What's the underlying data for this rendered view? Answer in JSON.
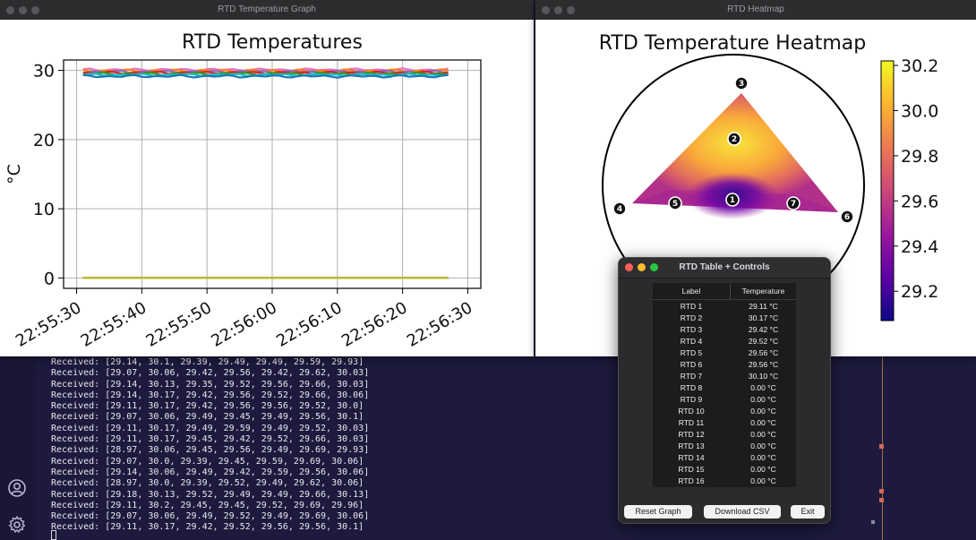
{
  "terminal": {
    "lines": [
      "Received: [29.14, 30.1, 29.39, 29.49, 29.49, 29.59, 29.93]",
      "Received: [29.07, 30.06, 29.42, 29.56, 29.42, 29.62, 30.03]",
      "Received: [29.14, 30.13, 29.35, 29.52, 29.56, 29.66, 30.03]",
      "Received: [29.14, 30.17, 29.42, 29.56, 29.52, 29.66, 30.06]",
      "Received: [29.11, 30.17, 29.42, 29.56, 29.56, 29.52, 30.0]",
      "Received: [29.07, 30.06, 29.49, 29.45, 29.49, 29.56, 30.1]",
      "Received: [29.11, 30.17, 29.49, 29.59, 29.49, 29.52, 30.03]",
      "Received: [29.11, 30.17, 29.45, 29.42, 29.52, 29.66, 30.03]",
      "Received: [28.97, 30.06, 29.45, 29.56, 29.49, 29.69, 29.93]",
      "Received: [29.07, 30.0, 29.39, 29.45, 29.59, 29.69, 30.06]",
      "Received: [29.14, 30.06, 29.49, 29.42, 29.59, 29.56, 30.06]",
      "Received: [28.97, 30.0, 29.39, 29.52, 29.49, 29.62, 30.06]",
      "Received: [29.18, 30.13, 29.52, 29.49, 29.49, 29.66, 30.13]",
      "Received: [29.11, 30.2, 29.45, 29.45, 29.52, 29.69, 29.96]",
      "Received: [29.07, 30.06, 29.49, 29.52, 29.49, 29.69, 30.06]",
      "Received: [29.11, 30.17, 29.42, 29.52, 29.56, 29.56, 30.1]"
    ],
    "sidebar_icons": [
      "account-icon",
      "settings-gear-icon"
    ]
  },
  "graph_window": {
    "title": "RTD Temperature Graph",
    "chart_data": {
      "type": "line",
      "title": "RTD Temperatures",
      "ylabel": "°C",
      "xlabel": "",
      "ylim": [
        -1.5,
        31.5
      ],
      "yticks": [
        0,
        10,
        20,
        30
      ],
      "x_tick_labels": [
        "22:55:30",
        "22:55:40",
        "22:55:50",
        "22:56:00",
        "22:56:10",
        "22:56:20",
        "22:56:30"
      ],
      "x_range_seconds": [
        -2,
        62
      ],
      "x_ticks_seconds": [
        0,
        10,
        20,
        30,
        40,
        50,
        60
      ],
      "data_x_range_seconds": [
        1,
        57
      ],
      "grid": true,
      "series": [
        {
          "color": "#e377c2",
          "level": 30.1
        },
        {
          "color": "#ff7f0e",
          "level": 29.95
        },
        {
          "color": "#9467bd",
          "level": 29.8
        },
        {
          "color": "#d62728",
          "level": 29.65
        },
        {
          "color": "#2ca02c",
          "level": 29.5
        },
        {
          "color": "#17becf",
          "level": 29.35
        },
        {
          "color": "#1f77b4",
          "level": 29.15
        },
        {
          "color": "#8c564b",
          "level": 0
        },
        {
          "color": "#7f7f7f",
          "level": 0
        },
        {
          "color": "#bcbd22",
          "level": 0
        }
      ]
    }
  },
  "heatmap_window": {
    "title": "RTD Heatmap",
    "chart_data": {
      "type": "heatmap",
      "title": "RTD Temperature Heatmap",
      "colorbar_ticks": [
        29.2,
        29.4,
        29.6,
        29.8,
        30.0,
        30.2
      ],
      "colorbar_range": [
        29.07,
        30.22
      ],
      "colormap": [
        "#0d0887",
        "#5c01a6",
        "#9c179e",
        "#cc4778",
        "#ed7953",
        "#fdb42f",
        "#f0f921"
      ],
      "sensors": [
        {
          "label": "1",
          "value": 29.11
        },
        {
          "label": "2",
          "value": 30.17
        },
        {
          "label": "3",
          "value": 29.42
        },
        {
          "label": "4",
          "value": 29.52
        },
        {
          "label": "5",
          "value": 29.56
        },
        {
          "label": "6",
          "value": 29.56
        },
        {
          "label": "7",
          "value": 30.1
        }
      ]
    }
  },
  "table_window": {
    "title": "RTD Table + Controls",
    "headers": {
      "label": "Label",
      "temperature": "Temperature"
    },
    "rows": [
      {
        "label": "RTD 1",
        "temp": "29.11 °C"
      },
      {
        "label": "RTD 2",
        "temp": "30.17 °C"
      },
      {
        "label": "RTD 3",
        "temp": "29.42 °C"
      },
      {
        "label": "RTD 4",
        "temp": "29.52 °C"
      },
      {
        "label": "RTD 5",
        "temp": "29.56 °C"
      },
      {
        "label": "RTD 6",
        "temp": "29.56 °C"
      },
      {
        "label": "RTD 7",
        "temp": "30.10 °C"
      },
      {
        "label": "RTD 8",
        "temp": "0.00 °C"
      },
      {
        "label": "RTD 9",
        "temp": "0.00 °C"
      },
      {
        "label": "RTD 10",
        "temp": "0.00 °C"
      },
      {
        "label": "RTD 11",
        "temp": "0.00 °C"
      },
      {
        "label": "RTD 12",
        "temp": "0.00 °C"
      },
      {
        "label": "RTD 13",
        "temp": "0.00 °C"
      },
      {
        "label": "RTD 14",
        "temp": "0.00 °C"
      },
      {
        "label": "RTD 15",
        "temp": "0.00 °C"
      },
      {
        "label": "RTD 16",
        "temp": "0.00 °C"
      }
    ],
    "buttons": {
      "reset": "Reset Graph",
      "download": "Download CSV",
      "exit": "Exit"
    }
  },
  "colors": {
    "terminal_bg": "#1d1a3d",
    "traffic_light_red": "#ff5f57",
    "traffic_light_yellow": "#febc2e",
    "traffic_light_green": "#28c840"
  }
}
